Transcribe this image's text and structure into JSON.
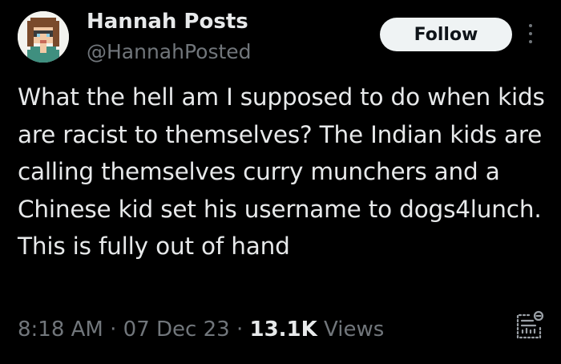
{
  "tweet": {
    "author_name": "Hannah Posts",
    "author_handle": "@HannahPosted",
    "follow_label": "Follow",
    "text": "What the hell am I supposed to do when kids are racist to themselves? The Indian kids are calling themselves curry munchers and a Chinese kid set his username to dogs4lunch. This is fully out of hand",
    "time": "8:18 AM",
    "separator": " · ",
    "date": "07 Dec 23",
    "views_count": "13.1K",
    "views_label": "Views"
  },
  "icons": {
    "avatar": "pixel-art-avatar",
    "more": "more-options-icon",
    "analytics": "analytics-icon"
  },
  "colors": {
    "background": "#000000",
    "primary_text": "#e7e9ea",
    "secondary_text": "#71767b",
    "follow_bg": "#eff3f4",
    "follow_text": "#0f1419"
  }
}
